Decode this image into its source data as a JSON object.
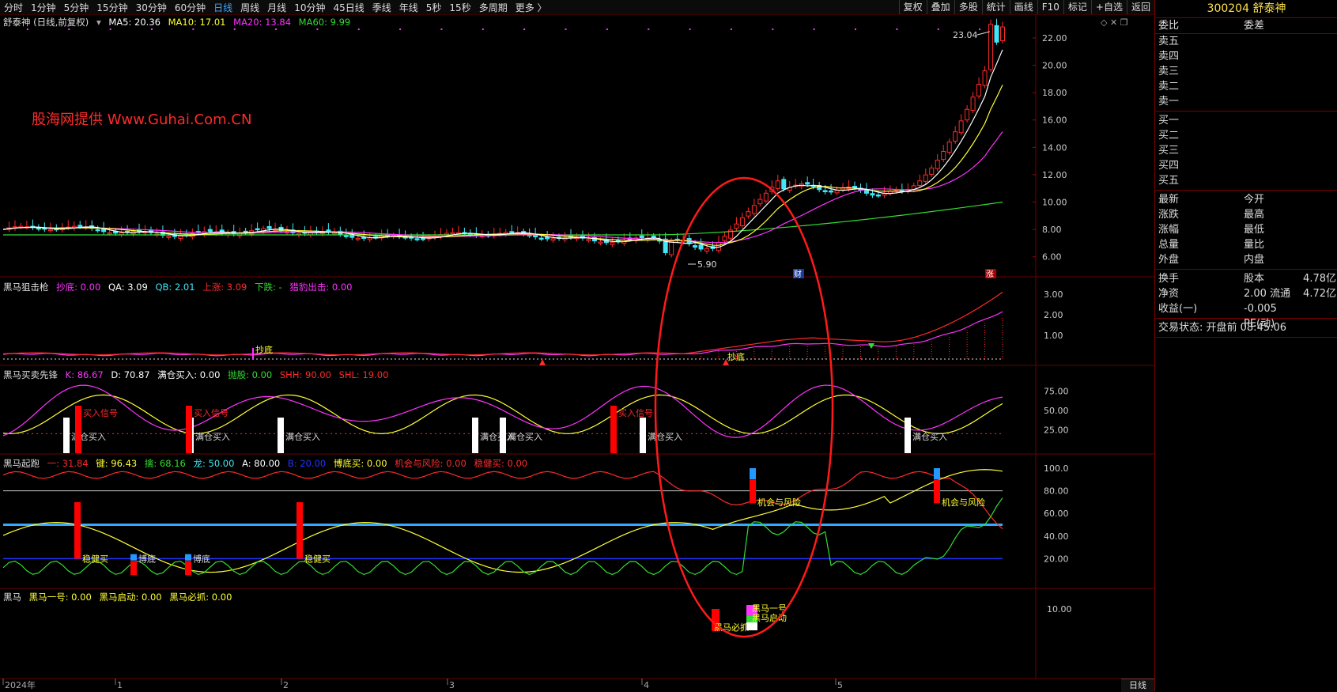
{
  "toolbar": {
    "periods": [
      "分时",
      "1分钟",
      "5分钟",
      "15分钟",
      "30分钟",
      "60分钟",
      "日线",
      "周线",
      "月线",
      "10分钟",
      "45日线",
      "季线",
      "年线",
      "5秒",
      "15秒",
      "多周期",
      "更多 〉"
    ],
    "active_period": "日线",
    "right_buttons": [
      "复权",
      "叠加",
      "多股",
      "统计",
      "画线",
      "F10",
      "标记",
      "+自选",
      "返回"
    ]
  },
  "main_panel": {
    "title": "舒泰神 (日线,前复权)",
    "ma5": "MA5: 20.36",
    "ma10": "MA10: 17.01",
    "ma20": "MA20: 13.84",
    "ma60": "MA60: 9.99",
    "watermark": "股海网提供 Www.Guhai.Com.CN",
    "high_label": "23.04",
    "low_label": "5.90",
    "fin_badge": "财",
    "up_badge": "涨",
    "y_ticks": [
      "22.00",
      "20.00",
      "18.00",
      "16.00",
      "14.00",
      "12.00",
      "10.00",
      "8.00",
      "6.00"
    ]
  },
  "panel2": {
    "title": "黑马狙击枪",
    "v1": "抄底: 0.00",
    "v2": "QA: 3.09",
    "v3": "QB: 2.01",
    "v4": "上涨: 3.09",
    "v5": "下跌: -",
    "v6": "猎豹出击: 0.00",
    "label_a": "抄底",
    "label_b": "抄底",
    "y_ticks": [
      "3.00",
      "2.00",
      "1.00"
    ]
  },
  "panel3": {
    "title": "黑马买卖先锋",
    "v1": "K: 86.67",
    "v2": "D: 70.87",
    "v3": "满仓买入: 0.00",
    "v4": "抛股: 0.00",
    "v5": "SHH: 90.00",
    "v6": "SHL: 19.00",
    "buy_signal": "买入信号",
    "full_buy": "满仓买入",
    "y_ticks": [
      "75.00",
      "50.00",
      "25.00"
    ]
  },
  "panel4": {
    "title": "黑马起跑",
    "v1": "一: 31.84",
    "v2": "键: 96.43",
    "v3": "擒: 68.16",
    "v4": "龙: 50.00",
    "v5": "A: 80.00",
    "v6": "B: 20.00",
    "v7": "博底买: 0.00",
    "v8": "机会与风险: 0.00",
    "v9": "稳健买: 0.00",
    "steady_buy": "稳健买",
    "bottom": "博底",
    "chance_risk": "机会与风险",
    "y_ticks": [
      "100.0",
      "80.00",
      "60.00",
      "40.00",
      "20.00"
    ]
  },
  "panel5": {
    "title": "黑马",
    "v1": "黑马一号: 0.00",
    "v2": "黑马启动: 0.00",
    "v3": "黑马必抓: 0.00",
    "lbl_no1": "黑马一号",
    "lbl_start": "黑马启动",
    "lbl_catch": "黑马必抓",
    "y_tick": "10.00"
  },
  "x_axis": {
    "labels": [
      "2024年",
      "1",
      "2",
      "3",
      "4",
      "5"
    ],
    "tab": "日线"
  },
  "right_panel": {
    "code_name": "300204 舒泰神",
    "header": [
      "委比",
      "委差"
    ],
    "sell": [
      "卖五",
      "卖四",
      "卖三",
      "卖二",
      "卖一"
    ],
    "buy": [
      "买一",
      "买二",
      "买三",
      "买四",
      "买五"
    ],
    "quote_rows": [
      [
        "最新",
        "今开",
        ""
      ],
      [
        "涨跌",
        "最高",
        ""
      ],
      [
        "涨幅",
        "最低",
        ""
      ],
      [
        "总量",
        "量比",
        ""
      ],
      [
        "外盘",
        "内盘",
        ""
      ]
    ],
    "fund_rows": [
      [
        "换手",
        "股本",
        "4.78亿"
      ],
      [
        "净资",
        "2.00 流通",
        "4.72亿"
      ],
      [
        "收益(一)",
        "-0.005 PE(动)",
        ""
      ]
    ],
    "trade_status": "交易状态: 开盘前 08:45:06"
  },
  "colors": {
    "up": "#ff2a2a",
    "down": "#3fe8f8",
    "ma5": "#ffffff",
    "ma10": "#ffff33",
    "ma20": "#ff33ff",
    "ma60": "#33dd33"
  }
}
